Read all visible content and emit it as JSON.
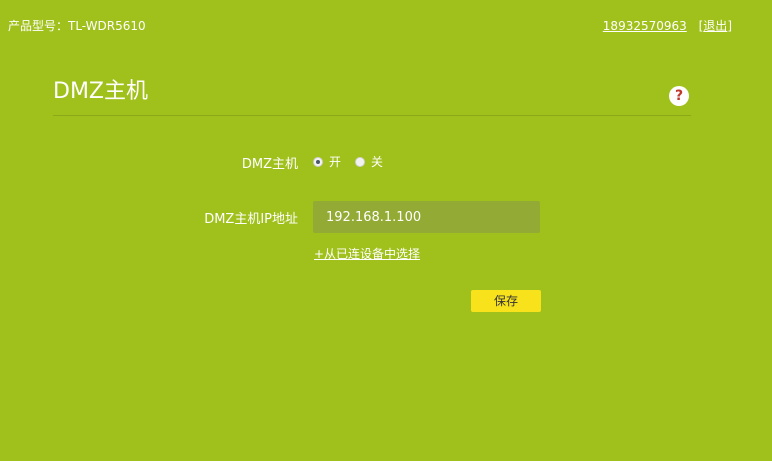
{
  "header": {
    "model_label": "产品型号：TL-WDR5610",
    "account": "18932570963",
    "logout_open": "[",
    "logout": "退出",
    "logout_close": "]"
  },
  "page": {
    "title": "DMZ主机",
    "help_symbol": "?"
  },
  "form": {
    "dmz_label": "DMZ主机",
    "dmz_options": [
      "开",
      "关"
    ],
    "dmz_selected": "开",
    "ip_label": "DMZ主机IP地址",
    "ip_value": "192.168.1.100",
    "select_device_link": "+从已连设备中选择",
    "save_label": "保存"
  },
  "colors": {
    "background": "#a0c01b",
    "input_background": "#93aa35",
    "save_button": "#f7e21c",
    "help_icon": "#c0392b"
  }
}
